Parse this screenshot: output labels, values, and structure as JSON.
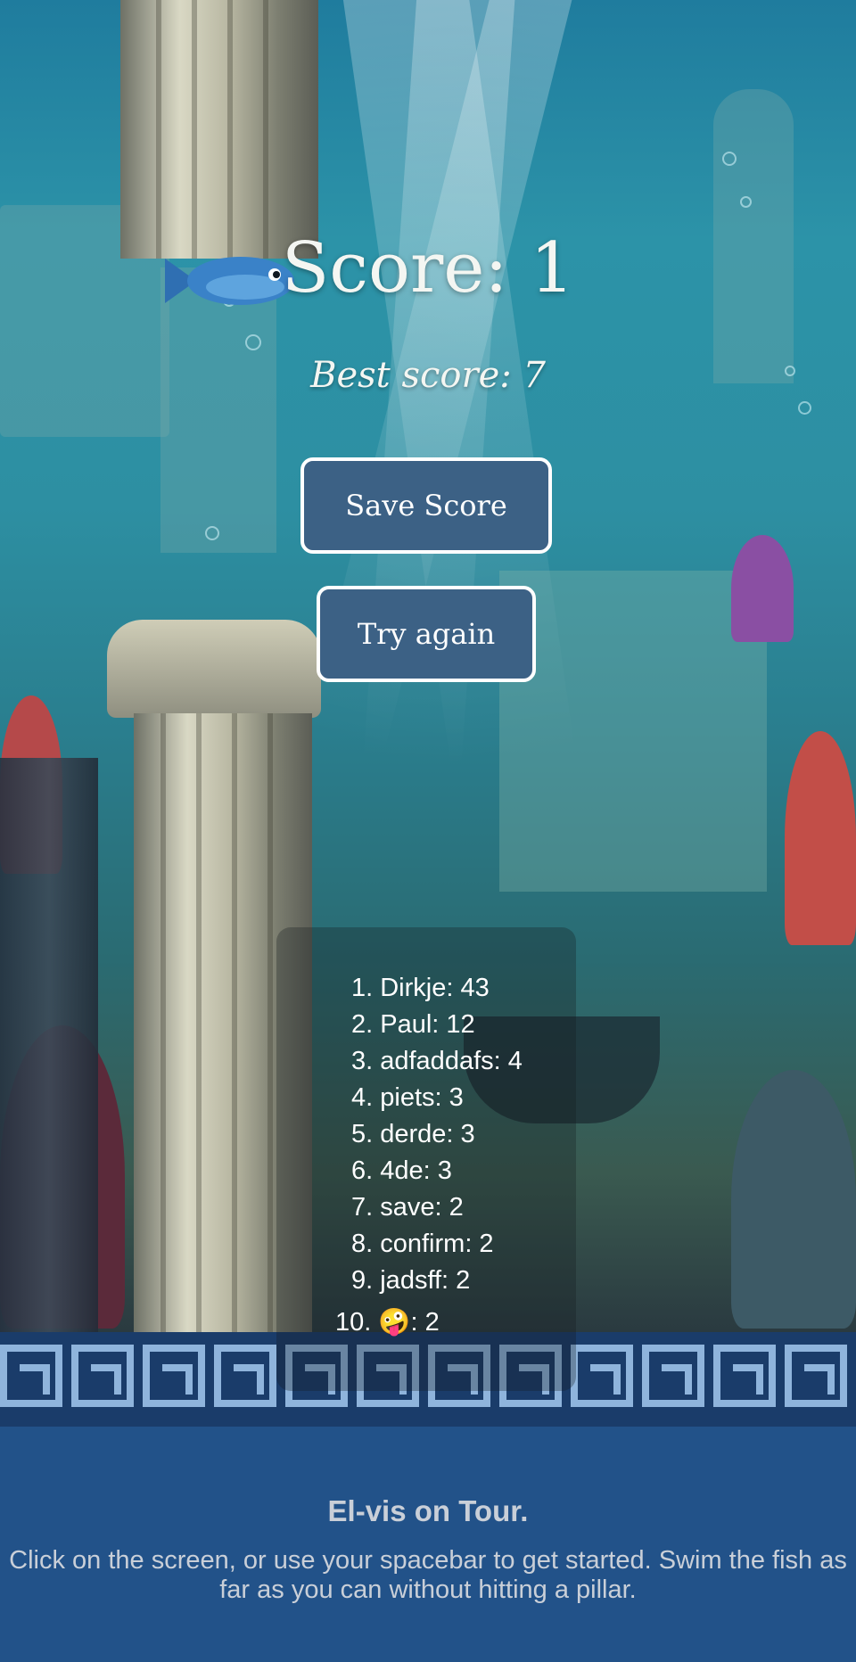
{
  "game": {
    "score_text": "Score: 1",
    "best_score_text": "Best score: 7"
  },
  "buttons": {
    "save_label": "Save Score",
    "retry_label": "Try again"
  },
  "leaderboard": {
    "entries": [
      "1. Dirkje: 43",
      "2. Paul: 12",
      "3. adfaddafs: 4",
      "4. piets: 3",
      "5. derde: 3",
      "6. 4de: 3",
      "7. save: 2",
      "8. confirm: 2",
      "9. jadsff: 2",
      "10. 🤪: 2"
    ]
  },
  "footer": {
    "title": "El-vis on Tour.",
    "description": "Click on the screen, or use your spacebar to get started. Swim the fish as far as you can without hitting a pillar."
  },
  "colors": {
    "button_bg": "#3c6185",
    "footer_bg": "#225289",
    "meander_bg": "#1a3c6a",
    "meander_line": "#8fb4dc"
  }
}
